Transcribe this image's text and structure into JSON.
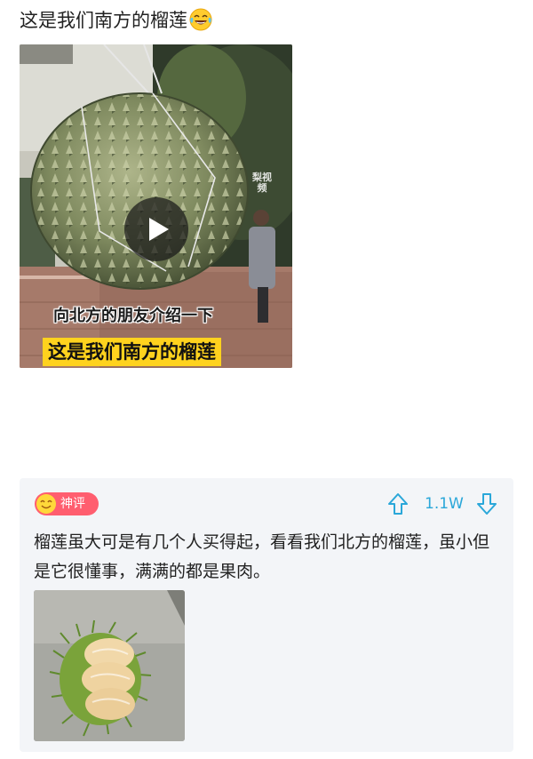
{
  "post": {
    "title": "这是我们南方的榴莲",
    "title_emoji": "laughing-tears-icon"
  },
  "video": {
    "caption_line1": "向北方的朋友介绍一下",
    "caption_line2": "这是我们南方的榴莲",
    "watermark": "梨视频",
    "caption_highlight_color": "#ffd21e"
  },
  "comment": {
    "badge_label": "神评",
    "badge_color": "#ff5e6f",
    "vote_count": "1.1W",
    "vote_color": "#2aa7d9",
    "text": "榴莲虽大可是有几个人买得起，看看我们北方的榴莲，虽小但是它很懂事，满满的都是果肉。"
  }
}
